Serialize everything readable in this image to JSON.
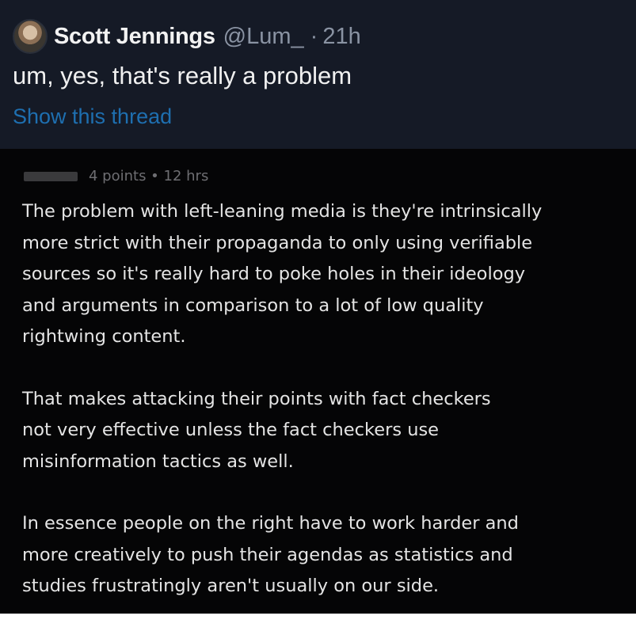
{
  "tweet": {
    "display_name": "Scott Jennings",
    "handle": "@Lum_",
    "separator": "·",
    "time": "21h",
    "text": "um, yes, that's really a problem",
    "show_thread": "Show this thread",
    "avatar_icon": "user-avatar-icon",
    "link_color": "#1e6fb0"
  },
  "comment": {
    "meta": "4 points • 12 hrs",
    "paragraphs": [
      {
        "lines": [
          "The problem with left-leaning media is they're intrinsically",
          "more strict with their propaganda to only using verifiable",
          "sources so it's really hard to poke holes in their ideology",
          "and arguments in comparison to a lot of low quality",
          "rightwing content."
        ]
      },
      {
        "lines": [
          "That makes attacking their points with fact checkers",
          "not very effective unless the fact checkers use",
          "misinformation tactics as well."
        ]
      },
      {
        "lines": [
          "In essence people on the right have to work harder and",
          "more creatively to push their agendas as statistics and",
          "studies frustratingly aren't usually on our side."
        ]
      }
    ]
  }
}
